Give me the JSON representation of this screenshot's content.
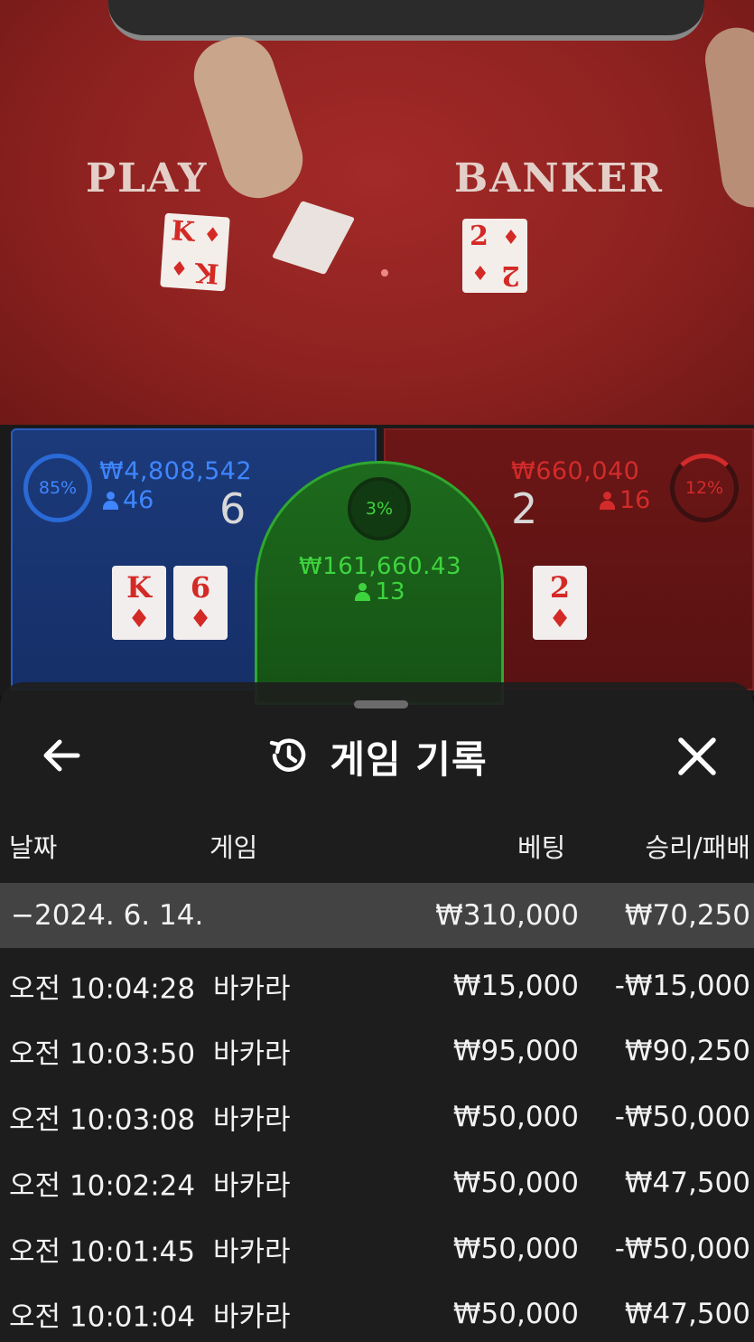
{
  "table": {
    "player_label": "PLAY",
    "banker_label": "BANKER",
    "cards": [
      {
        "rank": "K",
        "suit": "♦"
      },
      {
        "rank": "2",
        "suit": "♦"
      }
    ]
  },
  "bets": {
    "player": {
      "percent": "85%",
      "percent_value": 0.85,
      "amount": "₩4,808,542",
      "count": "46",
      "score": "6",
      "cards": [
        {
          "rank": "K",
          "suit": "♦"
        },
        {
          "rank": "6",
          "suit": "♦"
        }
      ],
      "color": "#2a6ad6"
    },
    "tie": {
      "percent": "3%",
      "percent_value": 0.03,
      "amount": "₩161,660.43",
      "count": "13",
      "color": "#2fbf2f"
    },
    "banker": {
      "percent": "12%",
      "percent_value": 0.12,
      "amount": "₩660,040",
      "count": "16",
      "score": "2",
      "cards": [
        {
          "rank": "2",
          "suit": "♦"
        }
      ],
      "color": "#d32b2b"
    }
  },
  "history": {
    "title": "게임 기록",
    "back_icon": "arrow-left-icon",
    "history_icon": "history-icon",
    "close_icon": "close-icon",
    "columns": {
      "date": "날짜",
      "game": "게임",
      "bet": "베팅",
      "result": "승리/패배"
    },
    "summary": {
      "date": "−2024. 6. 14.",
      "bet": "₩310,000",
      "result": "₩70,250"
    },
    "rows": [
      {
        "time": "오전 10:04:28",
        "game": "바카라",
        "bet": "₩15,000",
        "result": "-₩15,000"
      },
      {
        "time": "오전 10:03:50",
        "game": "바카라",
        "bet": "₩95,000",
        "result": "₩90,250"
      },
      {
        "time": "오전 10:03:08",
        "game": "바카라",
        "bet": "₩50,000",
        "result": "-₩50,000"
      },
      {
        "time": "오전 10:02:24",
        "game": "바카라",
        "bet": "₩50,000",
        "result": "₩47,500"
      },
      {
        "time": "오전 10:01:45",
        "game": "바카라",
        "bet": "₩50,000",
        "result": "-₩50,000"
      },
      {
        "time": "오전 10:01:04",
        "game": "바카라",
        "bet": "₩50,000",
        "result": "₩47,500"
      }
    ]
  }
}
